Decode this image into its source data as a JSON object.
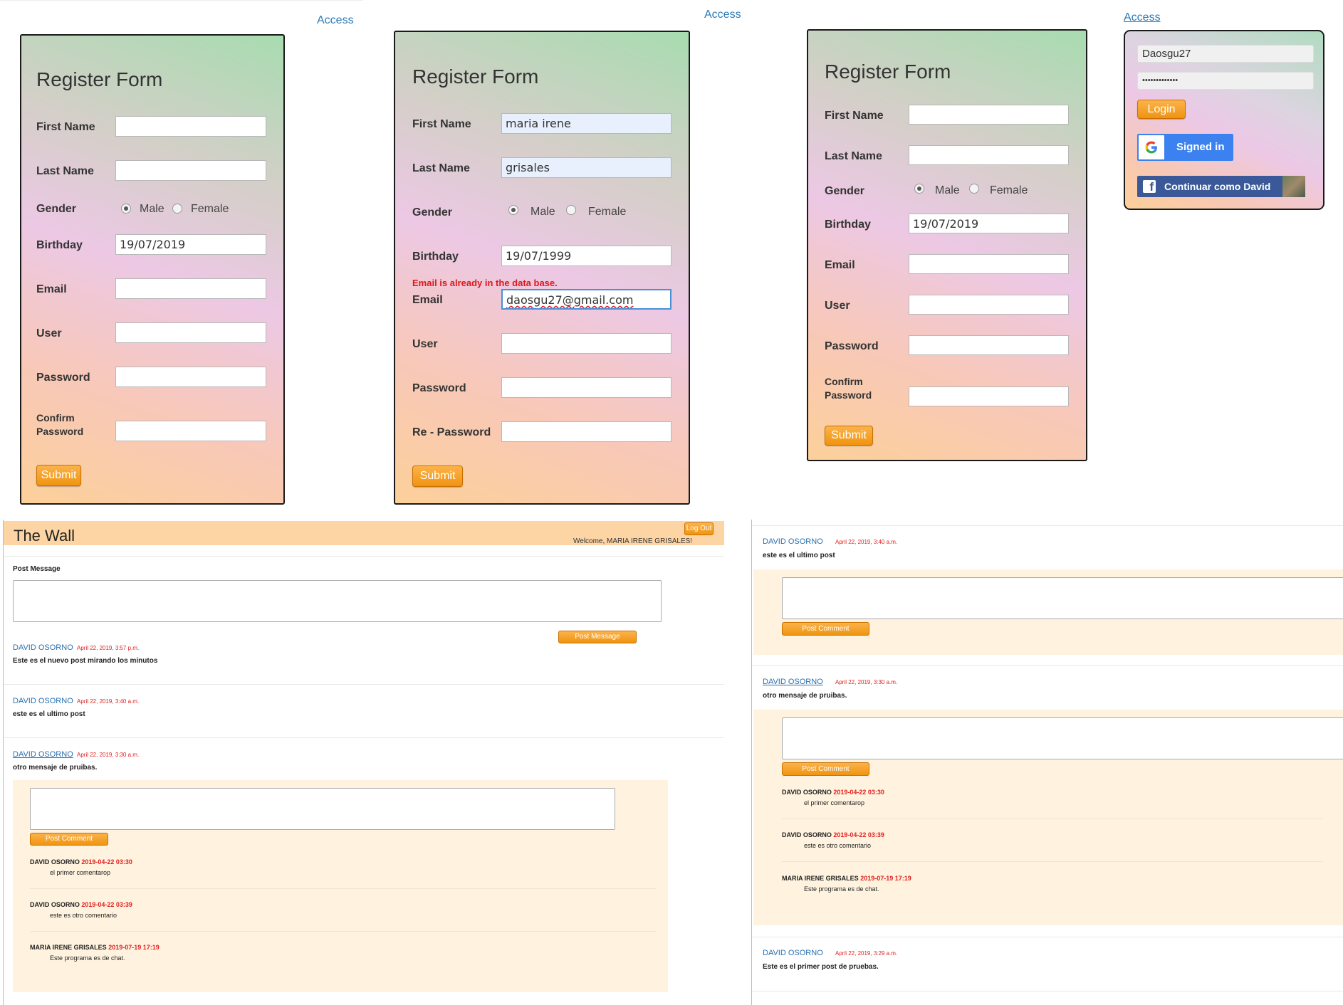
{
  "form1": {
    "access": "Access",
    "title": "Register Form",
    "labels": {
      "first": "First Name",
      "last": "Last Name",
      "gender": "Gender",
      "birthday": "Birthday",
      "email": "Email",
      "user": "User",
      "password": "Password",
      "confirm1": "Confirm",
      "confirm2": "Password"
    },
    "gender_options": {
      "male": "Male",
      "female": "Female"
    },
    "values": {
      "first": "",
      "last": "",
      "birthday": "19/07/2019",
      "email": "",
      "user": "",
      "password": "",
      "confirm": ""
    },
    "submit": "Submit"
  },
  "form2": {
    "access": "Access",
    "title": "Register Form",
    "labels": {
      "first": "First Name",
      "last": "Last Name",
      "gender": "Gender",
      "birthday": "Birthday",
      "email": "Email",
      "user": "User",
      "password": "Password",
      "repassword": "Re - Password"
    },
    "gender_options": {
      "male": "Male",
      "female": "Female"
    },
    "values": {
      "first": "maria irene",
      "last": "grisales",
      "birthday": "19/07/1999",
      "email": "daosgu27@gmail.com",
      "user": "",
      "password": "",
      "repassword": ""
    },
    "error": "Email is already in the data base.",
    "submit": "Submit"
  },
  "form3": {
    "title": "Register Form",
    "labels": {
      "first": "First Name",
      "last": "Last Name",
      "gender": "Gender",
      "birthday": "Birthday",
      "email": "Email",
      "user": "User",
      "password": "Password",
      "confirm1": "Confirm",
      "confirm2": "Password"
    },
    "gender_options": {
      "male": "Male",
      "female": "Female"
    },
    "values": {
      "first": "",
      "last": "",
      "birthday": "19/07/2019",
      "email": "",
      "user": "",
      "password": "",
      "confirm": ""
    },
    "submit": "Submit"
  },
  "login": {
    "access": "Access",
    "username": "Daosgu27",
    "password_mask": "•••••••••••••",
    "login_button": "Login",
    "google_button": "Signed in",
    "facebook_button": "Continuar como David"
  },
  "wall": {
    "title": "The Wall",
    "logout": "Log Out",
    "welcome": "Welcome, MARIA IRENE GRISALES!",
    "post_message_label": "Post Message",
    "post_message_button": "Post Message",
    "post_comment_button": "Post Comment",
    "posts": [
      {
        "author": "DAVID OSORNO",
        "time": "April 22, 2019, 3:57 p.m.",
        "text": "Este es el nuevo post mirando los minutos"
      },
      {
        "author": "DAVID OSORNO",
        "time": "April 22, 2019, 3:40 a.m.",
        "text": "este es el ultimo post"
      },
      {
        "author": "DAVID OSORNO",
        "time": "April 22, 2019, 3:30 a.m.",
        "text": "otro mensaje de pruibas."
      }
    ],
    "comments": [
      {
        "author": "DAVID OSORNO",
        "time": "2019-04-22 03:30",
        "text": "el primer comentarop"
      },
      {
        "author": "DAVID OSORNO",
        "time": "2019-04-22 03:39",
        "text": "este es otro comentario"
      },
      {
        "author": "MARIA IRENE GRISALES",
        "time": "2019-07-19 17:19",
        "text": "Este programa es de chat."
      }
    ]
  },
  "wall2": {
    "posts": [
      {
        "author": "DAVID OSORNO",
        "time": "April 22, 2019, 3:40 a.m.",
        "text": "este es el ultimo post"
      },
      {
        "author": "DAVID OSORNO",
        "time": "April 22, 2019, 3:30 a.m.",
        "text": "otro mensaje de pruibas."
      },
      {
        "author": "DAVID OSORNO",
        "time": "April 22, 2019, 3:29 a.m.",
        "text": "Este es el primer post de pruebas."
      }
    ],
    "post_comment_button": "Post Comment",
    "comments": [
      {
        "author": "DAVID OSORNO",
        "time": "2019-04-22 03:30",
        "text": "el primer comentarop"
      },
      {
        "author": "DAVID OSORNO",
        "time": "2019-04-22 03:39",
        "text": "este es otro comentario"
      },
      {
        "author": "MARIA IRENE GRISALES",
        "time": "2019-07-19 17:19",
        "text": "Este programa es de chat."
      }
    ]
  }
}
